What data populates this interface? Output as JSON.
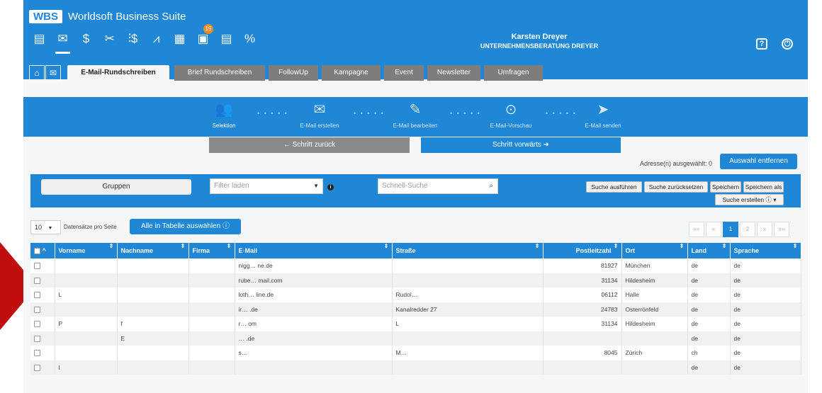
{
  "app": {
    "badge": "WBS",
    "title": "Worldsoft Business Suite"
  },
  "modules": [
    {
      "icon": "contact-card-icon"
    },
    {
      "icon": "mail-icon",
      "active": true
    },
    {
      "icon": "money-bag-icon"
    },
    {
      "icon": "tools-icon"
    },
    {
      "icon": "dollar-chart-icon"
    },
    {
      "icon": "line-chart-icon"
    },
    {
      "icon": "calendar-icon"
    },
    {
      "icon": "notes-icon",
      "badge": "19"
    },
    {
      "icon": "document-icon"
    },
    {
      "icon": "percent-icon"
    }
  ],
  "user": {
    "name": "Karsten Dreyer",
    "company": "UNTERNEHMENSBERATUNG DREYER"
  },
  "topright": {
    "help": "?",
    "power": "⏻"
  },
  "tabs": {
    "home": "⌂",
    "mail": "✉",
    "items": [
      "E-Mail-Rundschreiben",
      "Brief Rundschreiben",
      "FollowUp",
      "Kampagne",
      "Event",
      "Newsletter",
      "Umfragen"
    ]
  },
  "wizard": {
    "steps": [
      "Selektion",
      "E-Mail erstellen",
      "E-Mail bearbeiten",
      "E-Mail-Vorschau",
      "E-Mail senden"
    ]
  },
  "nav": {
    "back": "← Schritt zurück",
    "forward": "Schritt vorwärts ➜"
  },
  "selection": {
    "text": "Adresse(n) ausgewählt: 0",
    "clear": "Auswahl entfernen"
  },
  "filter": {
    "groups": "Gruppen",
    "filter_placeholder": "Filter laden",
    "search_placeholder": "Schnell-Suche",
    "run": "Suche ausführen",
    "reset": "Suche zurücksetzen",
    "save": "Speichern",
    "save_as": "Speichern als",
    "create": "Suche erstellen"
  },
  "table_controls": {
    "page_size": "10",
    "per_page": "Datensätze pro Seite",
    "select_all": "Alle in Tabelle auswählen",
    "pager": [
      "««",
      "«",
      "1",
      "2",
      "»",
      "»»"
    ]
  },
  "table": {
    "columns": [
      "Vorname",
      "Nachname",
      "Firma",
      "E-Mail",
      "Straße",
      "Postleitzahl",
      "Ort",
      "Land",
      "Sprache"
    ],
    "rows": [
      [
        "",
        "",
        "",
        "nigg… ne.de",
        "",
        "81927",
        "München",
        "de",
        "de"
      ],
      [
        "",
        "",
        "",
        "rube… mail.com",
        "",
        "31134",
        "Hildesheim",
        "de",
        "de"
      ],
      [
        "L",
        "",
        "",
        "loth… line.de",
        "Rudol…",
        "06112",
        "Halle",
        "de",
        "de"
      ],
      [
        "",
        "",
        "",
        "ir… .de",
        "Kanalredder 27",
        "24783",
        "Osterrönfeld",
        "de",
        "de"
      ],
      [
        "P",
        "f",
        "",
        "r… om",
        "L",
        "31134",
        "Hildesheim",
        "de",
        "de"
      ],
      [
        "",
        "E",
        "",
        "… .de",
        "",
        "",
        "",
        "de",
        "de"
      ],
      [
        "",
        "",
        "",
        "s…",
        "M…",
        "8045",
        "Zürich",
        "ch",
        "de"
      ],
      [
        "I",
        "",
        "",
        "",
        "",
        "",
        "",
        "de",
        "de"
      ]
    ]
  }
}
